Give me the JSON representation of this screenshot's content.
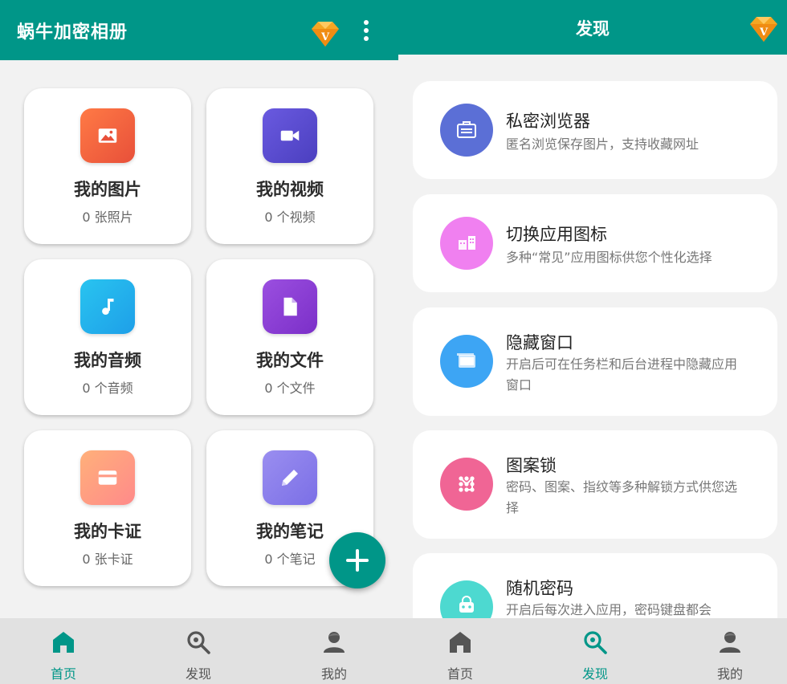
{
  "colors": {
    "primary": "#009688",
    "background": "#f2f2f2",
    "nav": "#e1e1e1",
    "vip": "#f5a623"
  },
  "home": {
    "title": "蜗牛加密相册",
    "cards": [
      {
        "title": "我的图片",
        "subtitle": "0 张照片",
        "icon": "image-icon",
        "gradient": [
          "#ff7a45",
          "#e8503a"
        ]
      },
      {
        "title": "我的视频",
        "subtitle": "0 个视频",
        "icon": "video-camera-icon",
        "gradient": [
          "#6a5ae0",
          "#4b3fbf"
        ]
      },
      {
        "title": "我的音频",
        "subtitle": "0 个音频",
        "icon": "music-note-icon",
        "gradient": [
          "#29c4f0",
          "#1e9fe8"
        ]
      },
      {
        "title": "我的文件",
        "subtitle": "0 个文件",
        "icon": "file-icon",
        "gradient": [
          "#9b4fe0",
          "#7b2fc8"
        ]
      },
      {
        "title": "我的卡证",
        "subtitle": "0 张卡证",
        "icon": "card-icon",
        "gradient": [
          "#ffb07a",
          "#ff8a8a"
        ]
      },
      {
        "title": "我的笔记",
        "subtitle": "0 个笔记",
        "icon": "pencil-icon",
        "gradient": [
          "#9a8ef0",
          "#7b6fe6"
        ]
      }
    ]
  },
  "discover": {
    "title": "发现",
    "items": [
      {
        "title": "私密浏览器",
        "desc": "匿名浏览保存图片，支持收藏网址",
        "icon": "briefcase-icon",
        "color": "#5b6fd6"
      },
      {
        "title": "切换应用图标",
        "desc": "多种“常见”应用图标供您个性化选择",
        "icon": "app-grid-icon",
        "color": "#f080f0"
      },
      {
        "title": "隐藏窗口",
        "desc": "开启后可在任务栏和后台进程中隐藏应用窗口",
        "icon": "window-icon",
        "color": "#3da5f4"
      },
      {
        "title": "图案锁",
        "desc": "密码、图案、指纹等多种解锁方式供您选择",
        "icon": "pattern-lock-icon",
        "color": "#f06595"
      },
      {
        "title": "随机密码",
        "desc": "开启后每次进入应用，密码键盘都会",
        "icon": "random-password-icon",
        "color": "#4dd9d0"
      }
    ]
  },
  "nav": {
    "home": "首页",
    "discover": "发现",
    "mine": "我的"
  }
}
